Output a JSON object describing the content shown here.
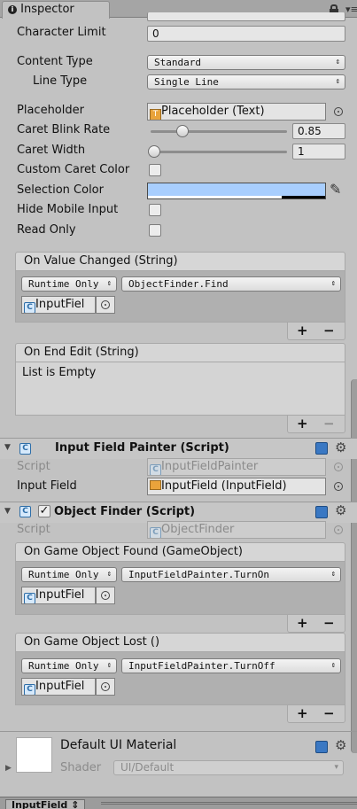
{
  "tab": {
    "title": "Inspector"
  },
  "input_field": {
    "character_limit": {
      "label": "Character Limit",
      "value": "0"
    },
    "content_type": {
      "label": "Content Type",
      "value": "Standard"
    },
    "line_type": {
      "label": "Line Type",
      "value": "Single Line"
    },
    "placeholder": {
      "label": "Placeholder",
      "value": "Placeholder (Text)"
    },
    "caret_blink_rate": {
      "label": "Caret Blink Rate",
      "value": "0.85",
      "slider_fraction": 0.21
    },
    "caret_width": {
      "label": "Caret Width",
      "value": "1",
      "slider_fraction": 0.0
    },
    "custom_caret_color": {
      "label": "Custom Caret Color",
      "checked": false
    },
    "selection_color": {
      "label": "Selection Color",
      "color": "#a8cefe"
    },
    "hide_mobile_input": {
      "label": "Hide Mobile Input",
      "checked": false
    },
    "read_only": {
      "label": "Read Only",
      "checked": false
    }
  },
  "events": {
    "value_changed": {
      "title": "On Value Changed (String)",
      "runtime": "Runtime Only",
      "function": "ObjectFinder.Find",
      "target": "InputFiel"
    },
    "end_edit": {
      "title": "On End Edit (String)",
      "empty_text": "List is Empty"
    }
  },
  "painter": {
    "title": "Input Field Painter (Script)",
    "script_label": "Script",
    "script_value": "InputFieldPainter",
    "input_field_label": "Input Field",
    "input_field_value": "InputField (InputField)"
  },
  "finder": {
    "title": "Object Finder (Script)",
    "script_label": "Script",
    "script_value": "ObjectFinder",
    "found": {
      "title": "On Game Object Found (GameObject)",
      "runtime": "Runtime Only",
      "function": "InputFieldPainter.TurnOn",
      "target": "InputFiel"
    },
    "lost": {
      "title": "On Game Object Lost ()",
      "runtime": "Runtime Only",
      "function": "InputFieldPainter.TurnOff",
      "target": "InputFiel"
    }
  },
  "material": {
    "name": "Default UI Material",
    "shader_label": "Shader",
    "shader_value": "UI/Default"
  },
  "footer": {
    "label": "InputField"
  },
  "controls": {
    "plus": "+",
    "minus": "−"
  }
}
